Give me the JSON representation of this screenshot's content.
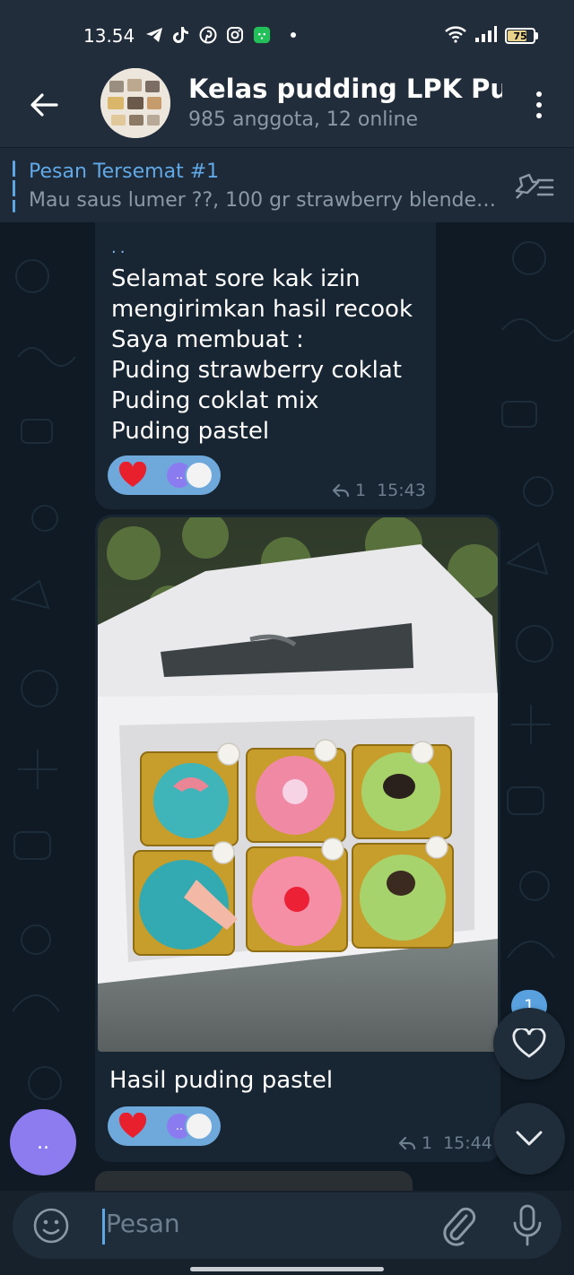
{
  "status_bar": {
    "time": "13.54",
    "app_icons": [
      "telegram-icon",
      "tiktok-icon",
      "pinterest-icon",
      "instagram-icon",
      "wechat-icon"
    ],
    "battery": "75",
    "battery_level": 0.75
  },
  "header": {
    "title": "Kelas pudding LPK Purwokerto",
    "subtitle": "985 anggota, 12 online"
  },
  "pinned": {
    "title": "Pesan Tersemat #1",
    "text": "Mau saus lumer ??,  100 gr strawberry blender..."
  },
  "messages": [
    {
      "sender": "..",
      "lines": [
        "Selamat sore kak izin",
        "mengirimkan hasil recook",
        "Saya membuat :",
        "Puding strawberry coklat",
        "Puding coklat mix",
        "Puding pastel"
      ],
      "replies": "1",
      "time": "15:43",
      "reaction_avatar": ".."
    },
    {
      "caption": "Hasil puding pastel",
      "replies": "1",
      "time": "15:44",
      "reaction_avatar": ".."
    }
  ],
  "floating": {
    "unread_count": "1",
    "sender_avatar": ".."
  },
  "input": {
    "placeholder": "Pesan"
  },
  "colors": {
    "accent": "#5ea7e4",
    "bubble": "#182533",
    "header": "#212d3b",
    "reaction": "#6fa9dc"
  }
}
